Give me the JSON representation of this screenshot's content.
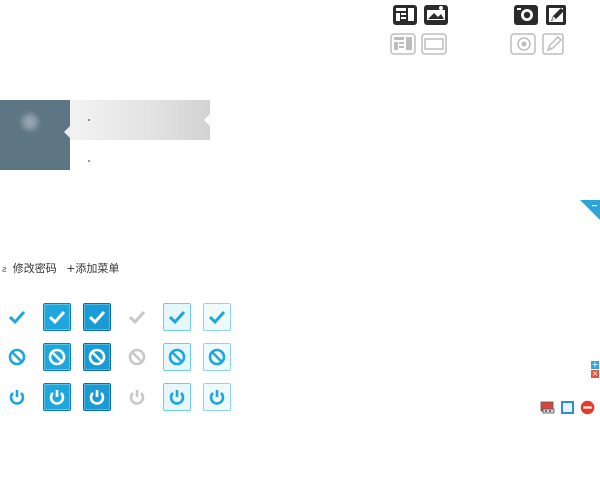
{
  "header_icons": [
    {
      "name": "newspaper-icon",
      "variant": "dark"
    },
    {
      "name": "image-frame-icon",
      "variant": "dark"
    },
    {
      "name": "camera-icon",
      "variant": "dark"
    },
    {
      "name": "edit-document-icon",
      "variant": "dark"
    },
    {
      "name": "newspaper-icon",
      "variant": "light"
    },
    {
      "name": "image-frame-icon",
      "variant": "light"
    },
    {
      "name": "camera-icon",
      "variant": "light"
    },
    {
      "name": "edit-document-icon",
      "variant": "light"
    }
  ],
  "links": {
    "change_password": "修改密码",
    "add_menu": "+添加菜单"
  },
  "state_icon_rows": [
    {
      "icon": "check-icon"
    },
    {
      "icon": "ban-icon"
    },
    {
      "icon": "power-icon"
    }
  ],
  "state_icon_styles": [
    "bare-blue",
    "filled-blue",
    "filled-blue-dark",
    "bare-gray",
    "outlined-light",
    "outlined-light-alt"
  ],
  "side_controls": {
    "plus": "+",
    "close": "×"
  },
  "toolbar_icons": [
    "card-reader-icon",
    "frame-icon",
    "remove-icon"
  ],
  "colors": {
    "accent_blue": "#1da7dd",
    "panel_slate": "#5e7584",
    "remove_red": "#e53a2a"
  }
}
